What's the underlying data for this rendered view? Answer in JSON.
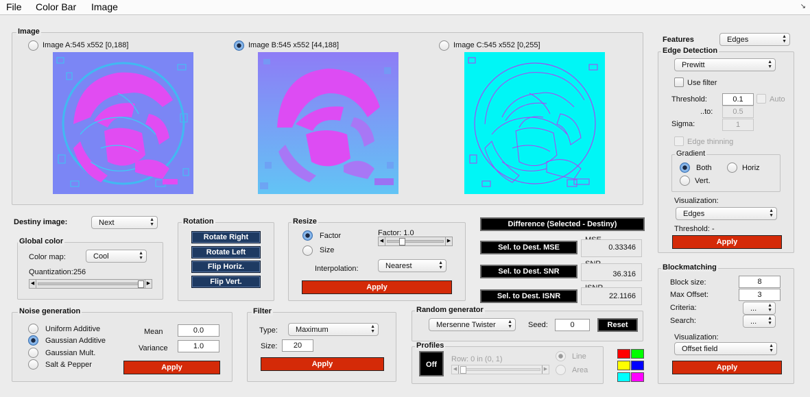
{
  "menu": {
    "file": "File",
    "colorbar": "Color Bar",
    "image": "Image"
  },
  "image_group": {
    "title": "Image",
    "a_label": "Image A:545 x552 [0,188]",
    "b_label": "Image B:545 x552 [44,188]",
    "c_label": "Image C:545 x552 [0,255]",
    "selected": "B"
  },
  "destiny": {
    "label": "Destiny image:",
    "value": "Next"
  },
  "global_color": {
    "title": "Global color",
    "colormap_label": "Color map:",
    "colormap_value": "Cool",
    "quantization_label": "Quantization:256",
    "quantization_level": 1.0
  },
  "rotation": {
    "title": "Rotation",
    "rotate_right": "Rotate Right",
    "rotate_left": "Rotate Left",
    "flip_h": "Flip Horiz.",
    "flip_v": "Flip Vert."
  },
  "resize": {
    "title": "Resize",
    "factor_label": "Factor",
    "size_label": "Size",
    "factor_value_label": "Factor: 1.0",
    "interp_label": "Interpolation:",
    "interp_value": "Nearest",
    "apply": "Apply"
  },
  "comparison": {
    "difference": "Difference (Selected - Destiny)",
    "mse_btn": "Sel. to Dest. MSE",
    "mse_label": "MSE",
    "mse_value": "0.33346",
    "snr_btn": "Sel. to Dest. SNR",
    "snr_label": "SNR",
    "snr_value": "36.316",
    "isnr_btn": "Sel. to Dest. ISNR",
    "isnr_label": "ISNR",
    "isnr_value": "22.1166"
  },
  "noise": {
    "title": "Noise generation",
    "uniform": "Uniform Additive",
    "gaussian": "Gaussian Additive",
    "gaussian_mult": "Gaussian Mult.",
    "salt_pepper": "Salt & Pepper",
    "mean_label": "Mean",
    "mean_value": "0.0",
    "variance_label": "Variance",
    "variance_value": "1.0",
    "apply": "Apply"
  },
  "filter": {
    "title": "Filter",
    "type_label": "Type:",
    "type_value": "Maximum",
    "size_label": "Size:",
    "size_value": "20",
    "apply": "Apply"
  },
  "random": {
    "title": "Random generator",
    "generator": "Mersenne Twister",
    "seed_label": "Seed:",
    "seed_value": "0",
    "reset": "Reset"
  },
  "profiles": {
    "title": "Profiles",
    "off": "Off",
    "row_label": "Row: 0 in (0, 1)",
    "line": "Line",
    "area": "Area"
  },
  "swatches": {
    "red": "#ff0000",
    "green": "#00ff00",
    "yellow": "#ffff00",
    "blue": "#0000ff",
    "cyan": "#00ffff",
    "magenta": "#ff00ff"
  },
  "features": {
    "label": "Features",
    "value": "Edges"
  },
  "edge": {
    "title": "Edge Detection",
    "method": "Prewitt",
    "use_filter": "Use filter",
    "threshold_label": "Threshold:",
    "threshold_value": "0.1",
    "auto": "Auto",
    "to_label": "..to:",
    "to_value": "0.5",
    "sigma_label": "Sigma:",
    "sigma_value": "1",
    "thinning": "Edge thinning",
    "gradient_title": "Gradient",
    "both": "Both",
    "horiz": "Horiz",
    "vert": "Vert.",
    "visualization_label": "Visualization:",
    "visualization_value": "Edges",
    "threshold_result": "Threshold: -",
    "apply": "Apply"
  },
  "blockmatching": {
    "title": "Blockmatching",
    "block_size_label": "Block size:",
    "block_size_value": "8",
    "max_offset_label": "Max Offset:",
    "max_offset_value": "3",
    "criteria_label": "Criteria:",
    "criteria_value": "...",
    "search_label": "Search:",
    "search_value": "...",
    "visualization_label": "Visualization:",
    "visualization_value": "Offset field",
    "apply": "Apply"
  }
}
